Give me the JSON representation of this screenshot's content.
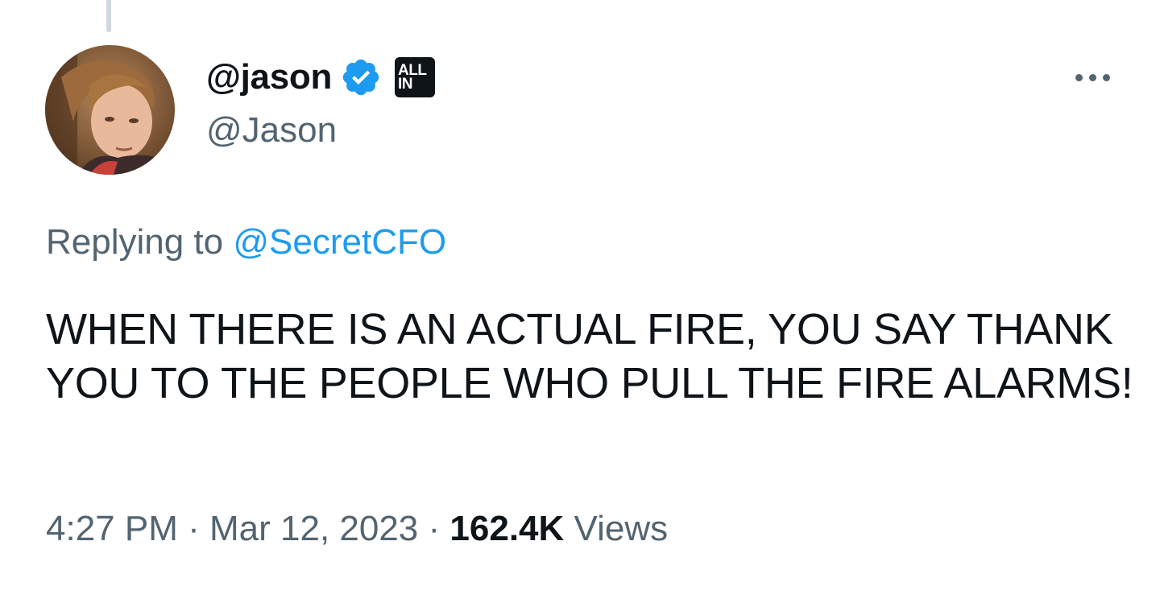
{
  "author": {
    "display_name": "@jason",
    "handle": "@Jason",
    "affiliate_badge": [
      "ALL",
      "IN"
    ],
    "verified_icon": "verified-check-icon",
    "verified_color": "#1d9bf0"
  },
  "reply": {
    "prefix": "Replying to",
    "mention": "@SecretCFO"
  },
  "tweet": {
    "text": "WHEN THERE IS AN ACTUAL FIRE, YOU SAY THANK YOU TO THE PEOPLE WHO PULL THE FIRE ALARMS!"
  },
  "meta": {
    "time": "4:27 PM",
    "separator": "·",
    "date": "Mar 12, 2023",
    "views_count": "162.4K",
    "views_label": "Views"
  },
  "colors": {
    "text_primary": "#0f1419",
    "text_secondary": "#536471",
    "link": "#1d9bf0"
  },
  "icons": {
    "more": "more-dots-icon"
  }
}
